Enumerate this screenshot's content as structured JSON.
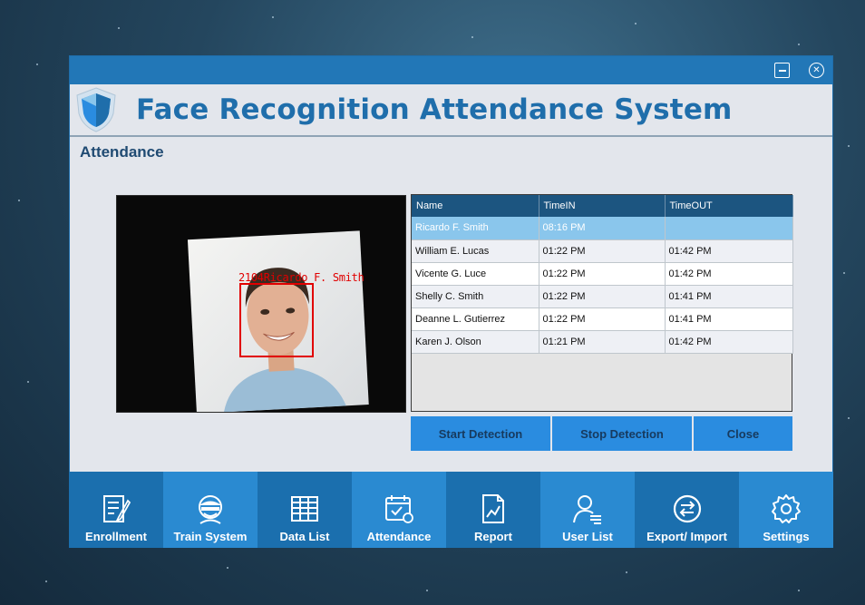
{
  "window": {
    "title": "Face Recognition Attendance System",
    "section": "Attendance"
  },
  "camera": {
    "overlay_label": "2104Ricardo F. Smith"
  },
  "table": {
    "headers": [
      "Name",
      "TimeIN",
      "TimeOUT"
    ],
    "rows": [
      {
        "name": "Ricardo F. Smith",
        "time_in": "08:16 PM",
        "time_out": ""
      },
      {
        "name": "William E. Lucas",
        "time_in": "01:22 PM",
        "time_out": "01:42 PM"
      },
      {
        "name": "Vicente G. Luce",
        "time_in": "01:22 PM",
        "time_out": "01:42 PM"
      },
      {
        "name": "Shelly C. Smith",
        "time_in": "01:22 PM",
        "time_out": "01:41 PM"
      },
      {
        "name": "Deanne L. Gutierrez",
        "time_in": "01:22 PM",
        "time_out": "01:41 PM"
      },
      {
        "name": "Karen J. Olson",
        "time_in": "01:21 PM",
        "time_out": "01:42 PM"
      }
    ]
  },
  "actions": {
    "start": "Start Detection",
    "stop": "Stop Detection",
    "close": "Close"
  },
  "nav": [
    {
      "label": "Enrollment",
      "icon": "enrollment-icon"
    },
    {
      "label": "Train System",
      "icon": "train-system-icon"
    },
    {
      "label": "Data List",
      "icon": "data-list-icon"
    },
    {
      "label": "Attendance",
      "icon": "attendance-icon"
    },
    {
      "label": "Report",
      "icon": "report-icon"
    },
    {
      "label": "User List",
      "icon": "user-list-icon"
    },
    {
      "label": "Export/ Import",
      "icon": "export-import-icon"
    },
    {
      "label": "Settings",
      "icon": "settings-icon"
    }
  ],
  "colors": {
    "titlebar": "#2277b7",
    "accent": "#1f6eab",
    "nav_dark": "#1b6fae",
    "nav_light": "#2a8ad1",
    "button": "#2a8ce0",
    "table_header": "#1c5580",
    "row_selected": "#8ac6ec",
    "detection": "#e10000"
  }
}
